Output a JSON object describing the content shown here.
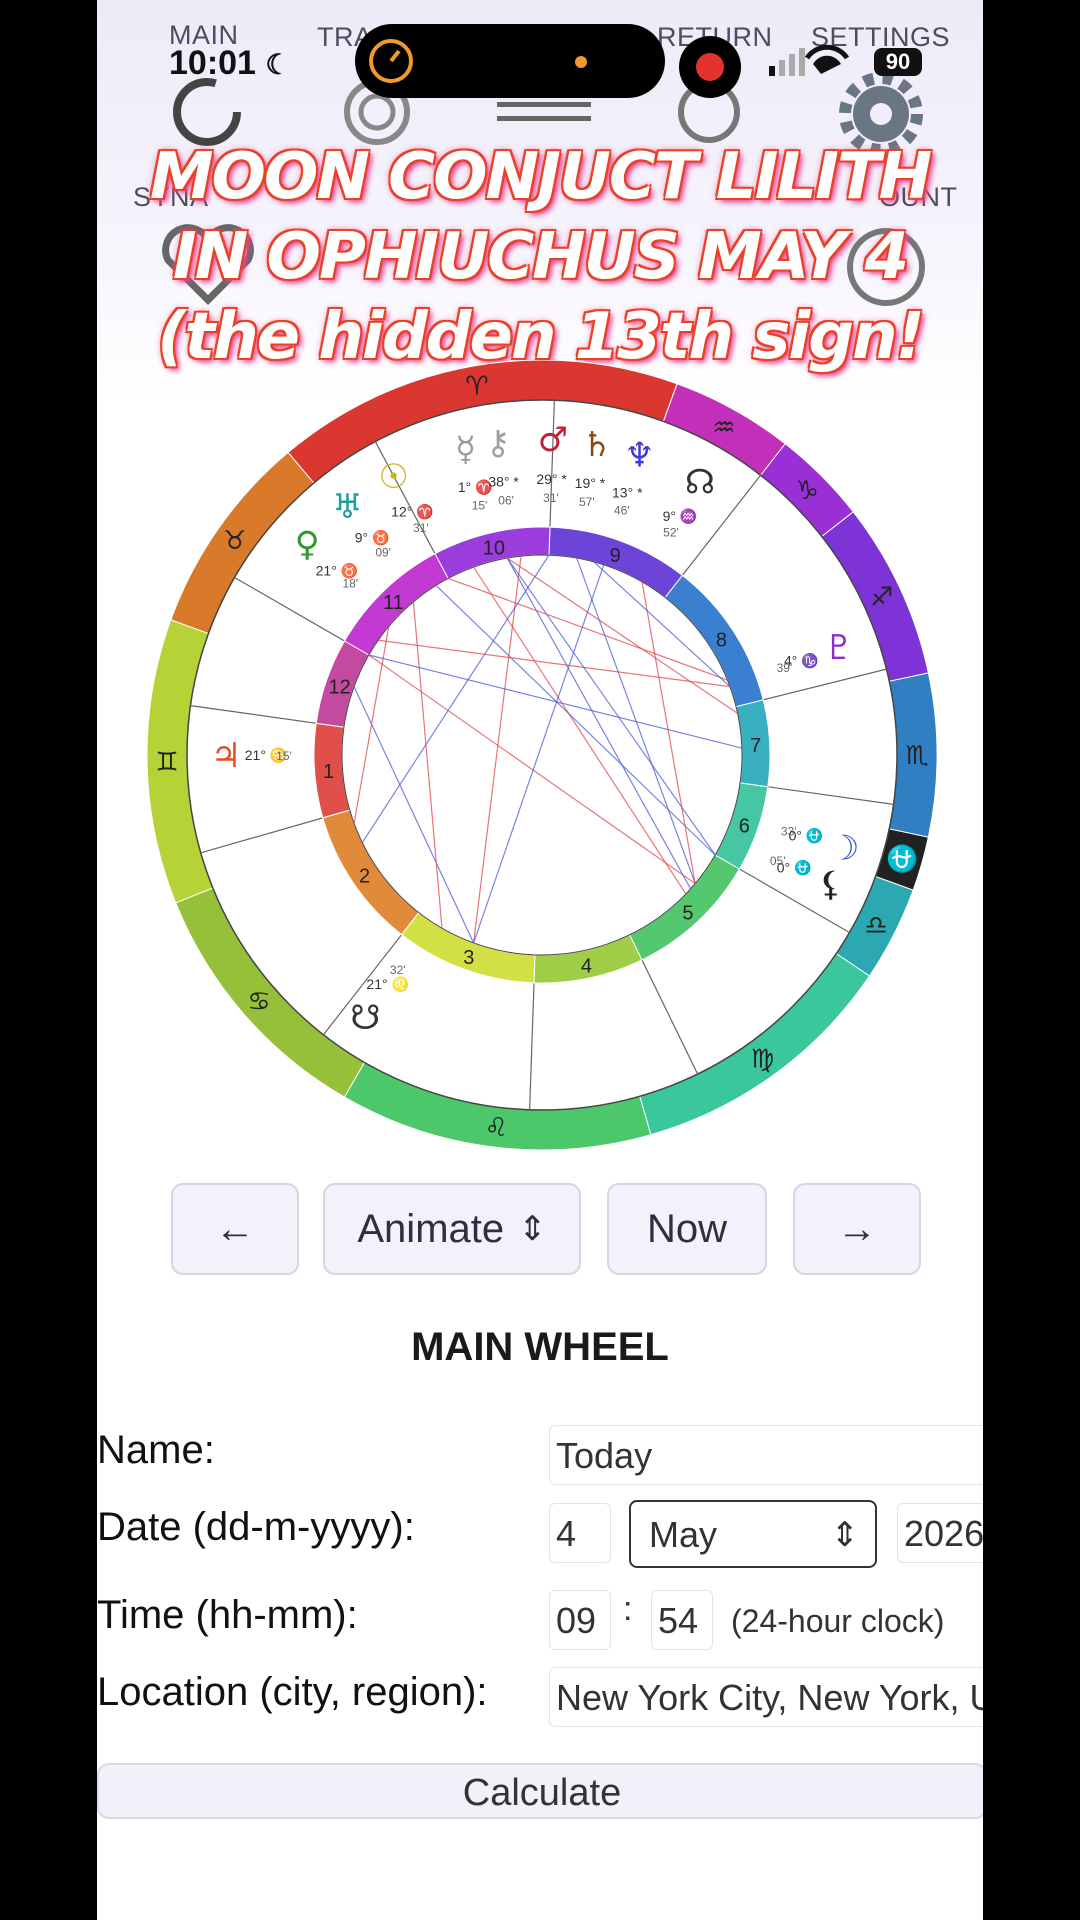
{
  "status": {
    "time": "10:01",
    "battery": "90"
  },
  "tabs": [
    {
      "label": "MAIN",
      "icon": "circle-icon"
    },
    {
      "label": "TRA",
      "icon": "double-circle-icon"
    },
    {
      "label": "RETURN",
      "icon": "return-icon"
    },
    {
      "label": "SETTINGS",
      "icon": "gear-icon"
    },
    {
      "label": "SYNA",
      "icon": "heart-icon"
    },
    {
      "label": "OUNT",
      "icon": "person-circle-icon"
    }
  ],
  "headline": {
    "line1": "MOON CONJUCT LILITH",
    "line2": "IN OPHIUCHUS MAY 4",
    "line3": "(the hidden 13th sign! ⛎✨)"
  },
  "chart_data": {
    "type": "astrology-wheel",
    "signs": [
      "♈",
      "♉",
      "♊",
      "♋",
      "♌",
      "♍",
      "♎",
      "⛎",
      "♏",
      "♐",
      "♑",
      "♒"
    ],
    "houses": [
      "1",
      "2",
      "3",
      "4",
      "5",
      "6",
      "7",
      "8",
      "9",
      "10",
      "11",
      "12"
    ],
    "planets": [
      {
        "glyph": "☉",
        "name": "Sun",
        "deg": "12°",
        "sign": "♈",
        "min": "31'"
      },
      {
        "glyph": "☿",
        "name": "Mercury",
        "deg": "1°",
        "sign": "♈",
        "min": "15'"
      },
      {
        "glyph": "⚷",
        "name": "Chiron",
        "deg": "38°",
        "sign": "*",
        "min": "06'"
      },
      {
        "glyph": "♂",
        "name": "Mars",
        "deg": "29°",
        "sign": "*",
        "min": "31'"
      },
      {
        "glyph": "♄",
        "name": "Saturn",
        "deg": "19°",
        "sign": "*",
        "min": "57'"
      },
      {
        "glyph": "♆",
        "name": "Neptune",
        "deg": "13°",
        "sign": "*",
        "min": "46'"
      },
      {
        "glyph": "♅",
        "name": "Uranus",
        "deg": "9°",
        "sign": "♉",
        "min": "09'"
      },
      {
        "glyph": "♀",
        "name": "Venus",
        "deg": "21°",
        "sign": "♉",
        "min": "18'"
      },
      {
        "glyph": "☊",
        "name": "North Node",
        "deg": "9°",
        "sign": "♒",
        "min": "52'"
      },
      {
        "glyph": "♇",
        "name": "Pluto",
        "deg": "4°",
        "sign": "♑",
        "min": "39'"
      },
      {
        "glyph": "♃",
        "name": "Jupiter",
        "deg": "21°",
        "sign": "♋",
        "min": "15'"
      },
      {
        "glyph": "☽",
        "name": "Moon",
        "deg": "0°",
        "sign": "⛎",
        "min": "33'"
      },
      {
        "glyph": "⚸",
        "name": "Lilith",
        "deg": "0°",
        "sign": "⛎",
        "min": "05'"
      },
      {
        "glyph": "☋",
        "name": "South Node",
        "deg": "21°",
        "sign": "♌",
        "min": "32'"
      }
    ],
    "retrograde_mark": "R",
    "colors": {
      "aspect_trine": "#4a5bd8",
      "aspect_square": "#e0474c"
    }
  },
  "controls": {
    "prev": "←",
    "animate": "Animate",
    "animate_chevron": "⇕",
    "now": "Now",
    "next": "→"
  },
  "form": {
    "title": "MAIN WHEEL",
    "name_label": "Name:",
    "name_value": "Today",
    "date_label": "Date (dd-m-yyyy):",
    "day": "4",
    "month": "May",
    "year": "2026",
    "time_label": "Time (hh-mm):",
    "hour": "09",
    "sep": ":",
    "minute": "54",
    "clock_note": "(24-hour clock)",
    "location_label": "Location (city, region):",
    "location_value": "New York City, New York, U",
    "calculate": "Calculate"
  }
}
